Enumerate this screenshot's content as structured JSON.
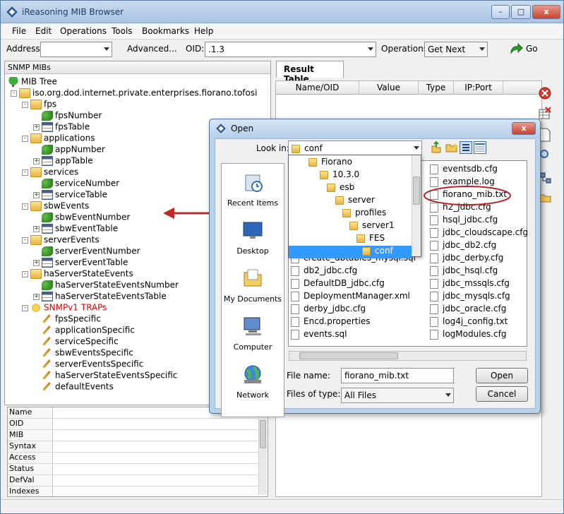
{
  "window": {
    "title": "iReasoning MIB Browser",
    "min": "–",
    "max": "□",
    "close": "x"
  },
  "menu": [
    "File",
    "Edit",
    "Operations",
    "Tools",
    "Bookmarks",
    "Help"
  ],
  "toolbar": {
    "address_label": "Address:",
    "address_value": "",
    "advanced_label": "Advanced...",
    "oid_label": "OID:",
    "oid_value": ".1.3",
    "operations_label": "Operations:",
    "operation_value": "Get Next",
    "go_label": "Go"
  },
  "left": {
    "header": "SNMP MIBs",
    "tree": [
      {
        "label": "MIB Tree",
        "icon": "tree"
      },
      {
        "label": "iso.org.dod.internet.private.enterprises.fiorano.tofosi",
        "icon": "folder"
      },
      {
        "label": "fps",
        "icon": "folder"
      },
      {
        "label": "fpsNumber",
        "icon": "leaf"
      },
      {
        "label": "fpsTable",
        "icon": "table"
      },
      {
        "label": "applications",
        "icon": "folder"
      },
      {
        "label": "appNumber",
        "icon": "leaf"
      },
      {
        "label": "appTable",
        "icon": "table"
      },
      {
        "label": "services",
        "icon": "folder"
      },
      {
        "label": "serviceNumber",
        "icon": "leaf"
      },
      {
        "label": "serviceTable",
        "icon": "table"
      },
      {
        "label": "sbwEvents",
        "icon": "folder"
      },
      {
        "label": "sbwEventNumber",
        "icon": "leaf"
      },
      {
        "label": "sbwEventTable",
        "icon": "table"
      },
      {
        "label": "serverEvents",
        "icon": "folder"
      },
      {
        "label": "serverEventNumber",
        "icon": "leaf"
      },
      {
        "label": "serverEventTable",
        "icon": "table"
      },
      {
        "label": "haServerStateEvents",
        "icon": "folder"
      },
      {
        "label": "haServerStateEventsNumber",
        "icon": "leaf"
      },
      {
        "label": "haServerStateEventsTable",
        "icon": "table"
      },
      {
        "label": "SNMPv1 TRAPs",
        "icon": "traps"
      },
      {
        "label": "fpsSpecific",
        "icon": "trap"
      },
      {
        "label": "applicationSpecific",
        "icon": "trap"
      },
      {
        "label": "serviceSpecific",
        "icon": "trap"
      },
      {
        "label": "sbwEventsSpecific",
        "icon": "trap"
      },
      {
        "label": "serverEventsSpecific",
        "icon": "trap"
      },
      {
        "label": "haServerStateEventsSpecific",
        "icon": "trap"
      },
      {
        "label": "defaultEvents",
        "icon": "trap"
      }
    ],
    "properties": [
      "Name",
      "OID",
      "MIB",
      "Syntax",
      "Access",
      "Status",
      "DefVal",
      "Indexes"
    ]
  },
  "result": {
    "tab": "Result Table",
    "columns": [
      "Name/OID",
      "Value",
      "Type",
      "IP:Port"
    ]
  },
  "dialog": {
    "title": "Open",
    "look_in_label": "Look in:",
    "look_in_value": "conf",
    "places": [
      "Recent Items",
      "Desktop",
      "My Documents",
      "Computer",
      "Network"
    ],
    "dropdown": [
      "Fiorano",
      "10.3.0",
      "esb",
      "server",
      "profiles",
      "server1",
      "FES",
      "conf"
    ],
    "files_left": [
      "create_dbtables_mysql.sql",
      "db2_jdbc.cfg",
      "DefaultDB_jdbc.cfg",
      "DeploymentManager.xml",
      "derby_jdbc.cfg",
      "Encd.properties",
      "events.sql"
    ],
    "files_right": [
      "eventsdb.cfg",
      "example.log",
      "fiorano_mib.txt",
      "h2_jdbc.cfg",
      "hsql_jdbc.cfg",
      "jdbc_cloudscape.cfg",
      "jdbc_db2.cfg",
      "jdbc_derby.cfg",
      "jdbc_hsql.cfg",
      "jdbc_mssqls.cfg",
      "jdbc_mysqls.cfg",
      "jdbc_oracle.cfg",
      "log4j_config.txt",
      "logModules.cfg"
    ],
    "file_name_label": "File name:",
    "file_name_value": "fiorano_mib.txt",
    "files_of_type_label": "Files of type:",
    "files_of_type_value": "All Files",
    "open_label": "Open",
    "cancel_label": "Cancel"
  }
}
